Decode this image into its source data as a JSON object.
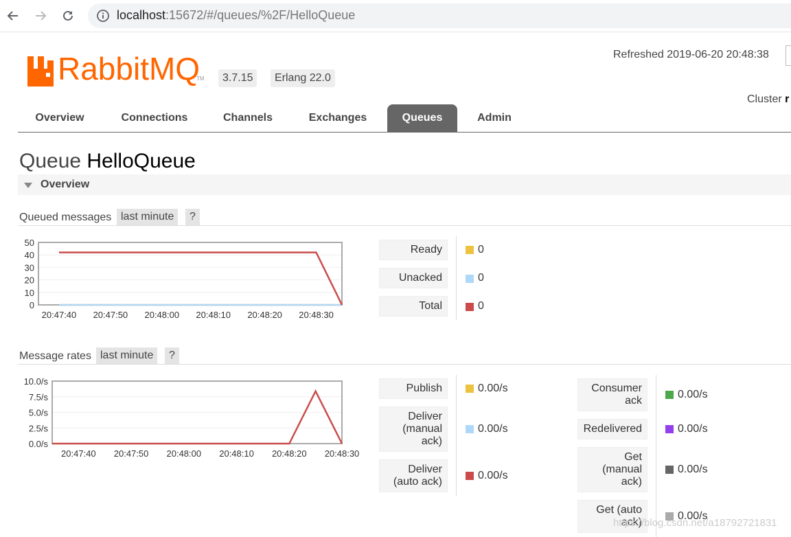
{
  "browser": {
    "url_host": "localhost",
    "url_path": ":15672/#/queues/%2F/HelloQueue"
  },
  "header": {
    "logo_text": "RabbitMQ",
    "logo_tm": "TM",
    "version": "3.7.15",
    "erlang": "Erlang 22.0",
    "refreshed": "Refreshed 2019-06-20 20:48:38",
    "cluster_label": "Cluster",
    "cluster_value": "r"
  },
  "tabs": [
    {
      "label": "Overview",
      "active": false
    },
    {
      "label": "Connections",
      "active": false
    },
    {
      "label": "Channels",
      "active": false
    },
    {
      "label": "Exchanges",
      "active": false
    },
    {
      "label": "Queues",
      "active": true
    },
    {
      "label": "Admin",
      "active": false
    }
  ],
  "page": {
    "title_prefix": "Queue",
    "queue_name": "HelloQueue",
    "section": "Overview"
  },
  "queued": {
    "title": "Queued messages",
    "range": "last minute",
    "help": "?",
    "legend": [
      {
        "label": "Ready",
        "value": "0",
        "color": "#edc240"
      },
      {
        "label": "Unacked",
        "value": "0",
        "color": "#afd8f8"
      },
      {
        "label": "Total",
        "value": "0",
        "color": "#cb4b4b"
      }
    ]
  },
  "rates": {
    "title": "Message rates",
    "range": "last minute",
    "help": "?",
    "legend_left": [
      {
        "label": "Publish",
        "value": "0.00/s",
        "color": "#edc240"
      },
      {
        "label": "Deliver (manual ack)",
        "value": "0.00/s",
        "color": "#afd8f8"
      },
      {
        "label": "Deliver (auto ack)",
        "value": "0.00/s",
        "color": "#cb4b4b"
      }
    ],
    "legend_right": [
      {
        "label": "Consumer ack",
        "value": "0.00/s",
        "color": "#4da74d"
      },
      {
        "label": "Redelivered",
        "value": "0.00/s",
        "color": "#9440ed"
      },
      {
        "label": "Get (manual ack)",
        "value": "0.00/s",
        "color": "#666666"
      },
      {
        "label": "Get (auto ack)",
        "value": "0.00/s",
        "color": "#aaaaaa"
      }
    ]
  },
  "chart_data": [
    {
      "type": "line",
      "title": "Queued messages",
      "x": [
        "20:47:40",
        "20:47:50",
        "20:48:00",
        "20:48:10",
        "20:48:20",
        "20:48:30",
        "20:48:35"
      ],
      "x_ticks": [
        "20:47:40",
        "20:47:50",
        "20:48:00",
        "20:48:10",
        "20:48:20",
        "20:48:30"
      ],
      "y_ticks": [
        "50",
        "40",
        "30",
        "20",
        "10",
        "0"
      ],
      "ylim": [
        0,
        50
      ],
      "grid": true,
      "series": [
        {
          "name": "Total",
          "color": "#cb4b4b",
          "values": [
            42,
            42,
            42,
            42,
            42,
            42,
            0
          ]
        },
        {
          "name": "Unacked",
          "color": "#afd8f8",
          "values": [
            0,
            0,
            0,
            0,
            0,
            0,
            0
          ]
        },
        {
          "name": "Ready",
          "color": "#edc240",
          "values": [
            0,
            0,
            0,
            0,
            0,
            0,
            0
          ]
        }
      ]
    },
    {
      "type": "line",
      "title": "Message rates",
      "x": [
        "20:47:35",
        "20:48:20",
        "20:48:25",
        "20:48:30"
      ],
      "x_ticks": [
        "20:47:40",
        "20:47:50",
        "20:48:00",
        "20:48:10",
        "20:48:20",
        "20:48:30"
      ],
      "y_ticks": [
        "10.0/s",
        "7.5/s",
        "5.0/s",
        "2.5/s",
        "0.0/s"
      ],
      "ylim": [
        0,
        10
      ],
      "grid": true,
      "series": [
        {
          "name": "Deliver (auto ack)",
          "color": "#cb4b4b",
          "values": [
            0,
            0,
            8.4,
            0
          ]
        }
      ]
    }
  ],
  "watermark": "https://blog.csdn.net/a18792721831"
}
